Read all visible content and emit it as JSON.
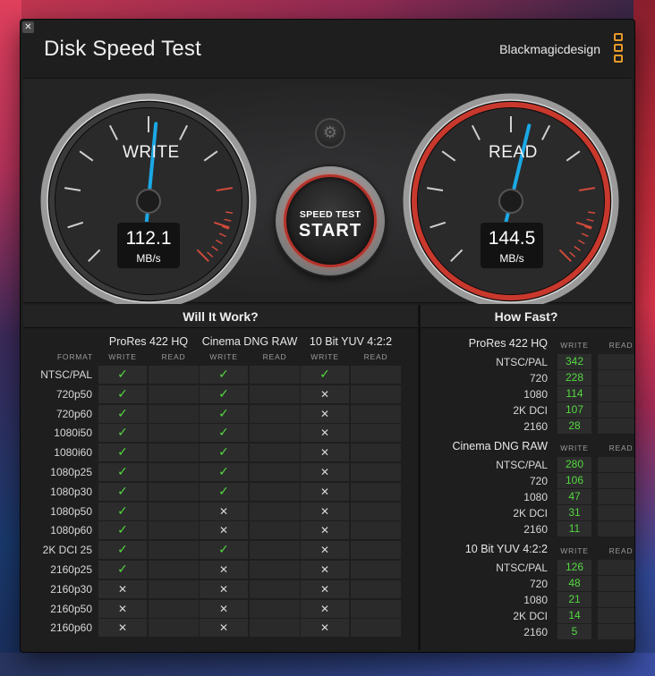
{
  "window": {
    "close_glyph": "✕",
    "title": "Disk Speed Test",
    "brand": "Blackmagicdesign"
  },
  "gauges": {
    "write": {
      "label": "WRITE",
      "value": "112.1",
      "unit": "MB/s",
      "needle_fraction": 0.52
    },
    "read": {
      "label": "READ",
      "value": "144.5",
      "unit": "MB/s",
      "needle_fraction": 0.55
    }
  },
  "controls": {
    "settings_glyph": "⚙",
    "start_small": "SPEED TEST",
    "start_big": "START"
  },
  "will_it_work": {
    "heading": "Will It Work?",
    "format_header": "FORMAT",
    "write_header": "WRITE",
    "read_header": "READ",
    "codecs": [
      "ProRes 422 HQ",
      "Cinema DNG RAW",
      "10 Bit YUV 4:2:2"
    ],
    "rows": [
      {
        "format": "NTSC/PAL",
        "results": [
          true,
          true,
          true
        ]
      },
      {
        "format": "720p50",
        "results": [
          true,
          true,
          false
        ]
      },
      {
        "format": "720p60",
        "results": [
          true,
          true,
          false
        ]
      },
      {
        "format": "1080i50",
        "results": [
          true,
          true,
          false
        ]
      },
      {
        "format": "1080i60",
        "results": [
          true,
          true,
          false
        ]
      },
      {
        "format": "1080p25",
        "results": [
          true,
          true,
          false
        ]
      },
      {
        "format": "1080p30",
        "results": [
          true,
          true,
          false
        ]
      },
      {
        "format": "1080p50",
        "results": [
          true,
          false,
          false
        ]
      },
      {
        "format": "1080p60",
        "results": [
          true,
          false,
          false
        ]
      },
      {
        "format": "2K DCI 25",
        "results": [
          true,
          true,
          false
        ]
      },
      {
        "format": "2160p25",
        "results": [
          true,
          false,
          false
        ]
      },
      {
        "format": "2160p30",
        "results": [
          false,
          false,
          false
        ]
      },
      {
        "format": "2160p50",
        "results": [
          false,
          false,
          false
        ]
      },
      {
        "format": "2160p60",
        "results": [
          false,
          false,
          false
        ]
      }
    ],
    "yes_glyph": "✓",
    "no_glyph": "✕"
  },
  "how_fast": {
    "heading": "How Fast?",
    "write_header": "WRITE",
    "read_header": "READ",
    "groups": [
      {
        "codec": "ProRes 422 HQ",
        "rows": [
          {
            "res": "NTSC/PAL",
            "write": "342"
          },
          {
            "res": "720",
            "write": "228"
          },
          {
            "res": "1080",
            "write": "114"
          },
          {
            "res": "2K DCI",
            "write": "107"
          },
          {
            "res": "2160",
            "write": "28"
          }
        ]
      },
      {
        "codec": "Cinema DNG RAW",
        "rows": [
          {
            "res": "NTSC/PAL",
            "write": "280"
          },
          {
            "res": "720",
            "write": "106"
          },
          {
            "res": "1080",
            "write": "47"
          },
          {
            "res": "2K DCI",
            "write": "31"
          },
          {
            "res": "2160",
            "write": "11"
          }
        ]
      },
      {
        "codec": "10 Bit YUV 4:2:2",
        "rows": [
          {
            "res": "NTSC/PAL",
            "write": "126"
          },
          {
            "res": "720",
            "write": "48"
          },
          {
            "res": "1080",
            "write": "21"
          },
          {
            "res": "2K DCI",
            "write": "14"
          },
          {
            "res": "2160",
            "write": "5"
          }
        ]
      }
    ]
  },
  "colors": {
    "accent_red": "#c8382c",
    "needle_blue": "#1aa9e6",
    "ok_green": "#54d93e",
    "brand_orange": "#e79a2a"
  }
}
